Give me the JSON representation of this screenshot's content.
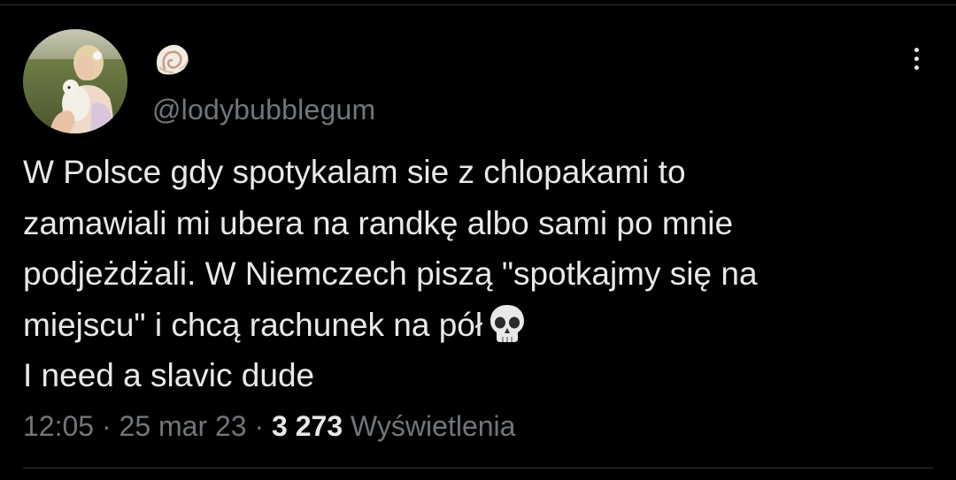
{
  "tweet": {
    "display_name_icon": "spiral-shell-emoji",
    "handle": "@lodybubblegum",
    "text_lines": [
      "W Polsce gdy spotykalam sie z chlopakami to",
      "zamawiali mi ubera na randkę albo sami po mnie",
      "podjeżdżali. W Niemczech piszą \"spotkajmy się na",
      "miejscu\" i chcą rachunek na pół",
      "I need a slavic dude"
    ],
    "emoji_icon": "skull-emoji",
    "time": "12:05",
    "separator": "·",
    "date": "25 mar 23",
    "views_count": "3 273",
    "views_label": "Wyświetlenia"
  },
  "colors": {
    "background": "#000000",
    "text_primary": "#e7e9ea",
    "text_secondary": "#71767b",
    "divider": "#2f3336"
  }
}
